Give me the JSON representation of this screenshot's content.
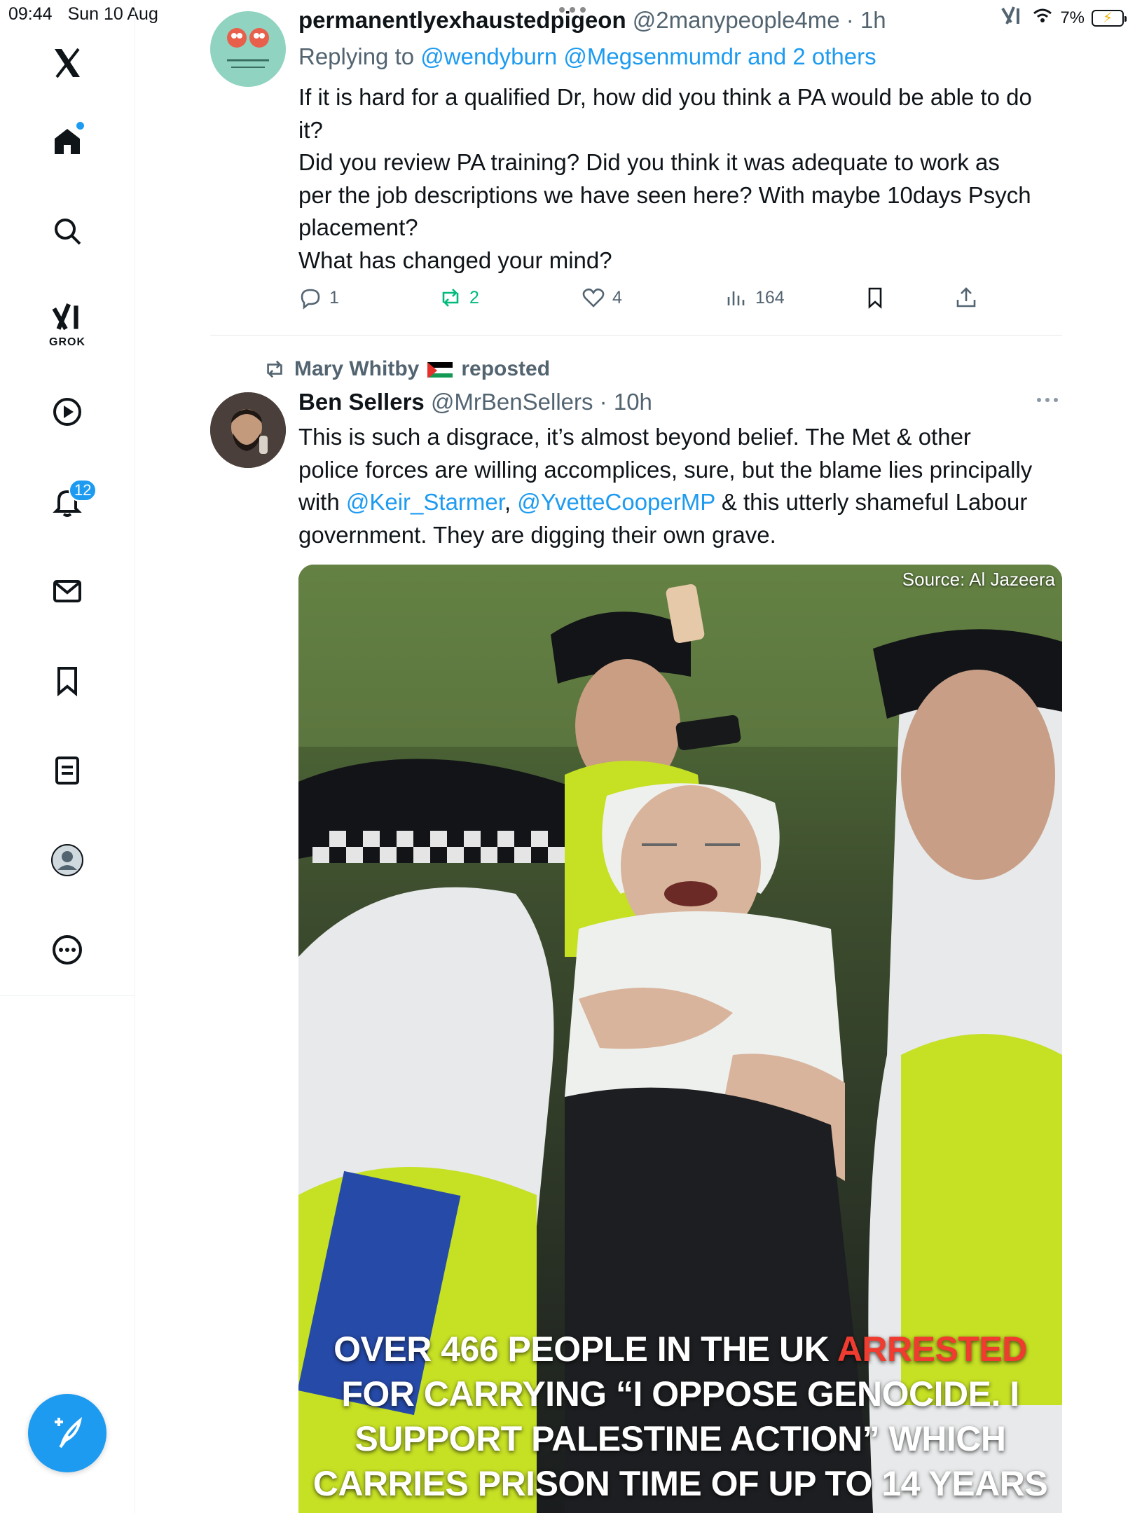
{
  "status_bar": {
    "time": "09:44",
    "date": "Sun 10 Aug",
    "battery": "7%"
  },
  "sidebar": {
    "items": [
      {
        "name": "x-logo"
      },
      {
        "name": "home",
        "has_dot": true
      },
      {
        "name": "search"
      },
      {
        "name": "grok",
        "label": "GROK"
      },
      {
        "name": "video"
      },
      {
        "name": "notifications",
        "badge": "12"
      },
      {
        "name": "messages"
      },
      {
        "name": "bookmarks"
      },
      {
        "name": "lists"
      },
      {
        "name": "profile"
      },
      {
        "name": "more"
      }
    ]
  },
  "tweet1": {
    "display_name": "permanentlyexhaustedpigeon",
    "handle": "@2manypeople4me",
    "time": "1h",
    "replying_prefix": "Replying to",
    "replying_to": "@wendyburn @Megsenmumdr and 2 others",
    "lines": [
      "If it is hard for a qualified Dr, how did you think a PA would be able to do",
      "it?",
      "Did you review PA training? Did you think it was adequate to work as",
      "per the job descriptions we have seen here? With maybe 10days Psych",
      "placement?",
      "What has changed your mind?"
    ],
    "replies": "1",
    "reposts": "2",
    "likes": "4",
    "views": "164"
  },
  "tweet2": {
    "reposted_by": "Mary Whitby",
    "reposted_label": "reposted",
    "display_name": "Ben Sellers",
    "handle": "@MrBenSellers",
    "time": "10h",
    "line1": "This is such a disgrace, it’s almost beyond belief. The Met & other",
    "line2": "police forces are willing accomplices, sure, but the blame lies principally",
    "line3_prefix": "with",
    "mention1": "@Keir_Starmer",
    "comma": ",",
    "mention2": "@YvetteCooperMP",
    "line3_suffix": "& this utterly shameful Labour",
    "line4": "government. They are digging their own grave.",
    "media": {
      "source": "Source: Al Jazeera",
      "headline_a": "Over 466 people in the UK",
      "headline_red": "arrested",
      "headline_b": "for carrying “I oppose genocide. I",
      "headline_c": "support Palestine Action” which",
      "headline_d": "carries prison time of up to 14 years"
    }
  },
  "colors": {
    "accent": "#1d9bf0",
    "repost_green": "#00ba7c",
    "text_secondary": "#536471",
    "headline_red": "#f03c30"
  }
}
